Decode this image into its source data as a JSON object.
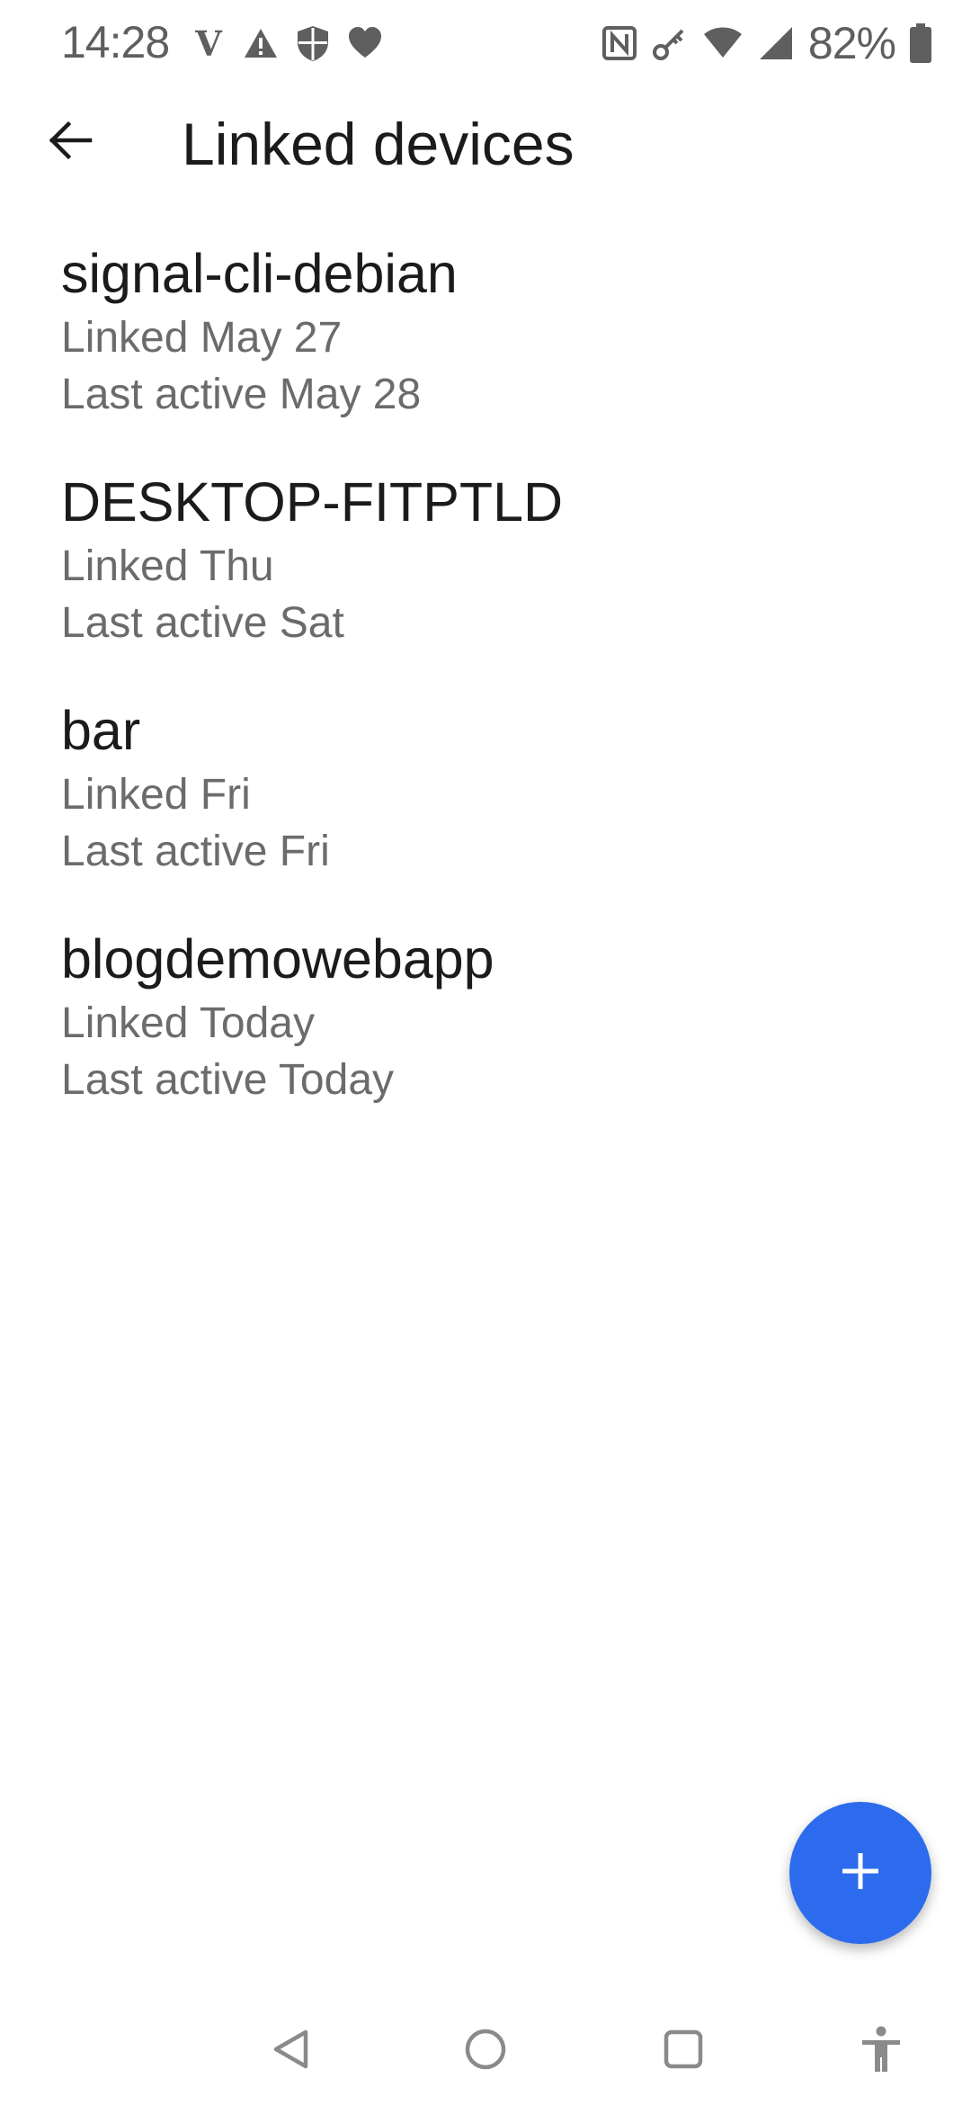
{
  "status_bar": {
    "time": "14:28",
    "battery_percent": "82%",
    "left_icons": [
      "v-app-icon",
      "warning-icon",
      "shield-icon",
      "heart-icon"
    ],
    "right_icons": [
      "nfc-icon",
      "key-icon",
      "wifi-icon",
      "cell-signal-icon",
      "battery-icon"
    ]
  },
  "app_bar": {
    "title": "Linked devices",
    "back_icon": "arrow-back-icon"
  },
  "devices": [
    {
      "name": "signal-cli-debian",
      "linked": "Linked May 27",
      "last_active": "Last active May 28"
    },
    {
      "name": "DESKTOP-FITPTLD",
      "linked": "Linked Thu",
      "last_active": "Last active Sat"
    },
    {
      "name": "bar",
      "linked": "Linked Fri",
      "last_active": "Last active Fri"
    },
    {
      "name": "blogdemowebapp",
      "linked": "Linked Today",
      "last_active": "Last active Today"
    }
  ],
  "fab": {
    "icon": "plus-icon",
    "color": "#2c6bed"
  },
  "nav_bar": {
    "icons": [
      "nav-back-icon",
      "nav-home-icon",
      "nav-recents-icon",
      "accessibility-icon"
    ]
  },
  "colors": {
    "primary_text": "#1b1b1b",
    "secondary_text": "#6b6b6b",
    "status_icons": "#5f5f5f",
    "accent": "#2c6bed"
  }
}
